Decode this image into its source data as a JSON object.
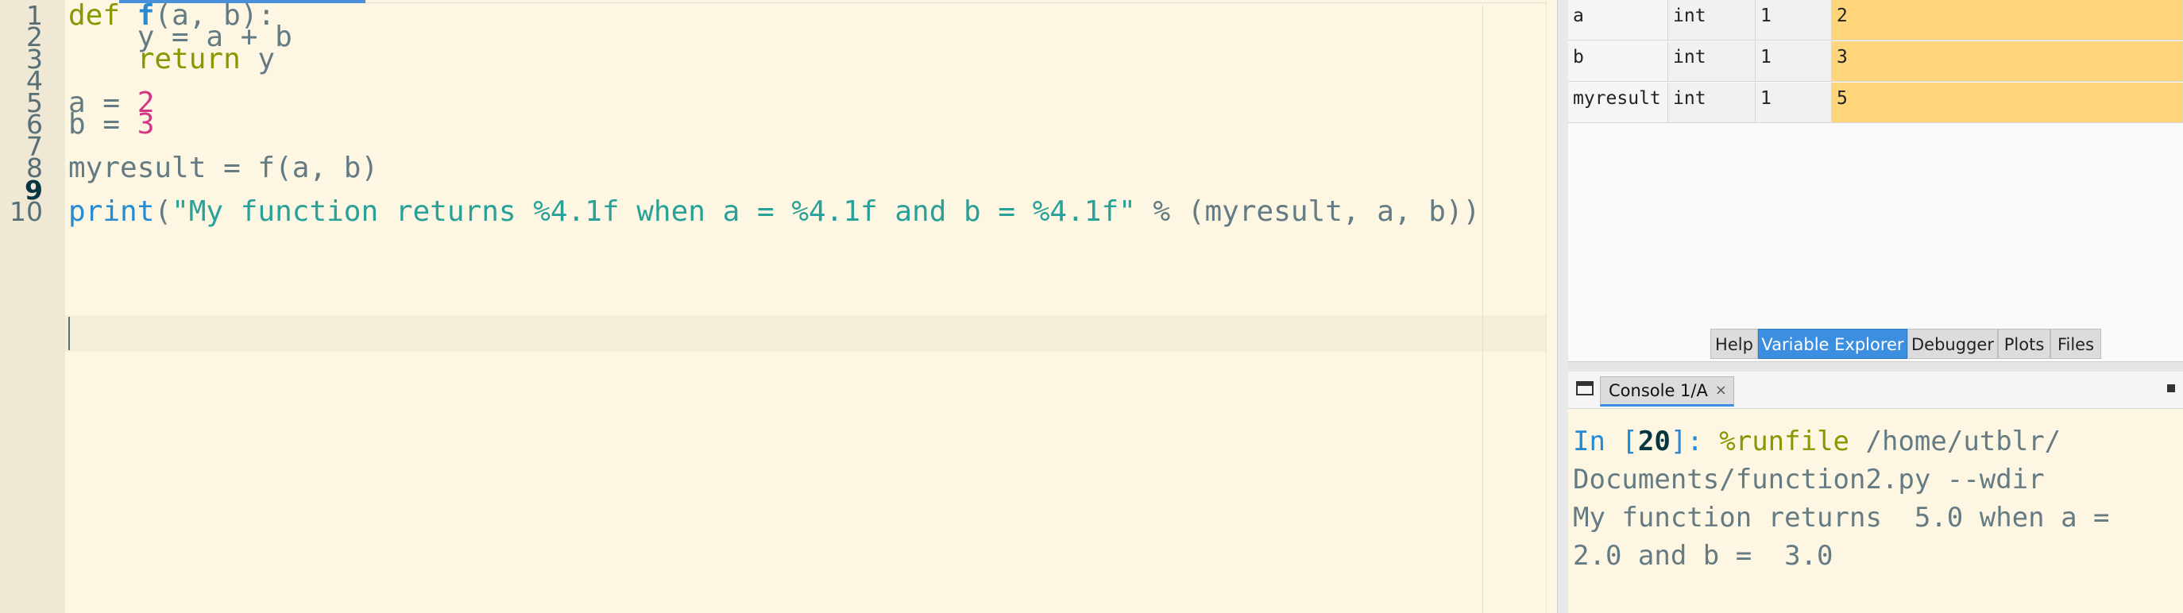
{
  "editor": {
    "line_numbers": [
      "1",
      "2",
      "3",
      "4",
      "5",
      "6",
      "7",
      "8",
      "9",
      "10"
    ],
    "current_line": "9",
    "lines": [
      {
        "kw": "def",
        "space": " ",
        "fn": "f",
        "rest": "(a, b):"
      },
      {
        "text": "    y = a + b"
      },
      {
        "indent": "    ",
        "kw": "return",
        "rest": " y"
      },
      {
        "text": ""
      },
      {
        "pre": "a = ",
        "num": "2"
      },
      {
        "pre": "b = ",
        "num": "3"
      },
      {
        "text": ""
      },
      {
        "text": "myresult = f(a, b)"
      },
      {
        "text": ""
      },
      {
        "builtin": "print",
        "open": "(",
        "str": "\"My function returns %4.1f when a = %4.1f and b = %4.1f\"",
        "rest": " % (myresult, a, b))"
      }
    ]
  },
  "variable_explorer": {
    "rows": [
      {
        "name": "a",
        "type": "int",
        "size": "1",
        "value": "2"
      },
      {
        "name": "b",
        "type": "int",
        "size": "1",
        "value": "3"
      },
      {
        "name": "myresult",
        "type": "int",
        "size": "1",
        "value": "5"
      }
    ],
    "value_bg_color": "#fed57b"
  },
  "pane_tabs": {
    "help": "Help",
    "variable_explorer": "Variable Explorer",
    "debugger": "Debugger",
    "plots": "Plots",
    "files": "Files",
    "active": "Variable Explorer"
  },
  "console": {
    "tab_label": "Console 1/A",
    "tab_close": "×",
    "prompt_in": "In [",
    "prompt_num": "20",
    "prompt_close": "]: ",
    "magic": "%runfile",
    "cmd_rest": " /home/utblr/",
    "cmd_line2": "Documents/function2.py --wdir",
    "output_line1": "My function returns  5.0 when a =",
    "output_line2": "2.0 and b =  3.0",
    "icons": [
      "browse-tabs-icon",
      "options-icon"
    ]
  },
  "colors": {
    "editor_bg": "#fdf6e3",
    "accent": "#3c8fe0",
    "keyword": "#859900",
    "number": "#d33682",
    "string": "#2aa198"
  }
}
